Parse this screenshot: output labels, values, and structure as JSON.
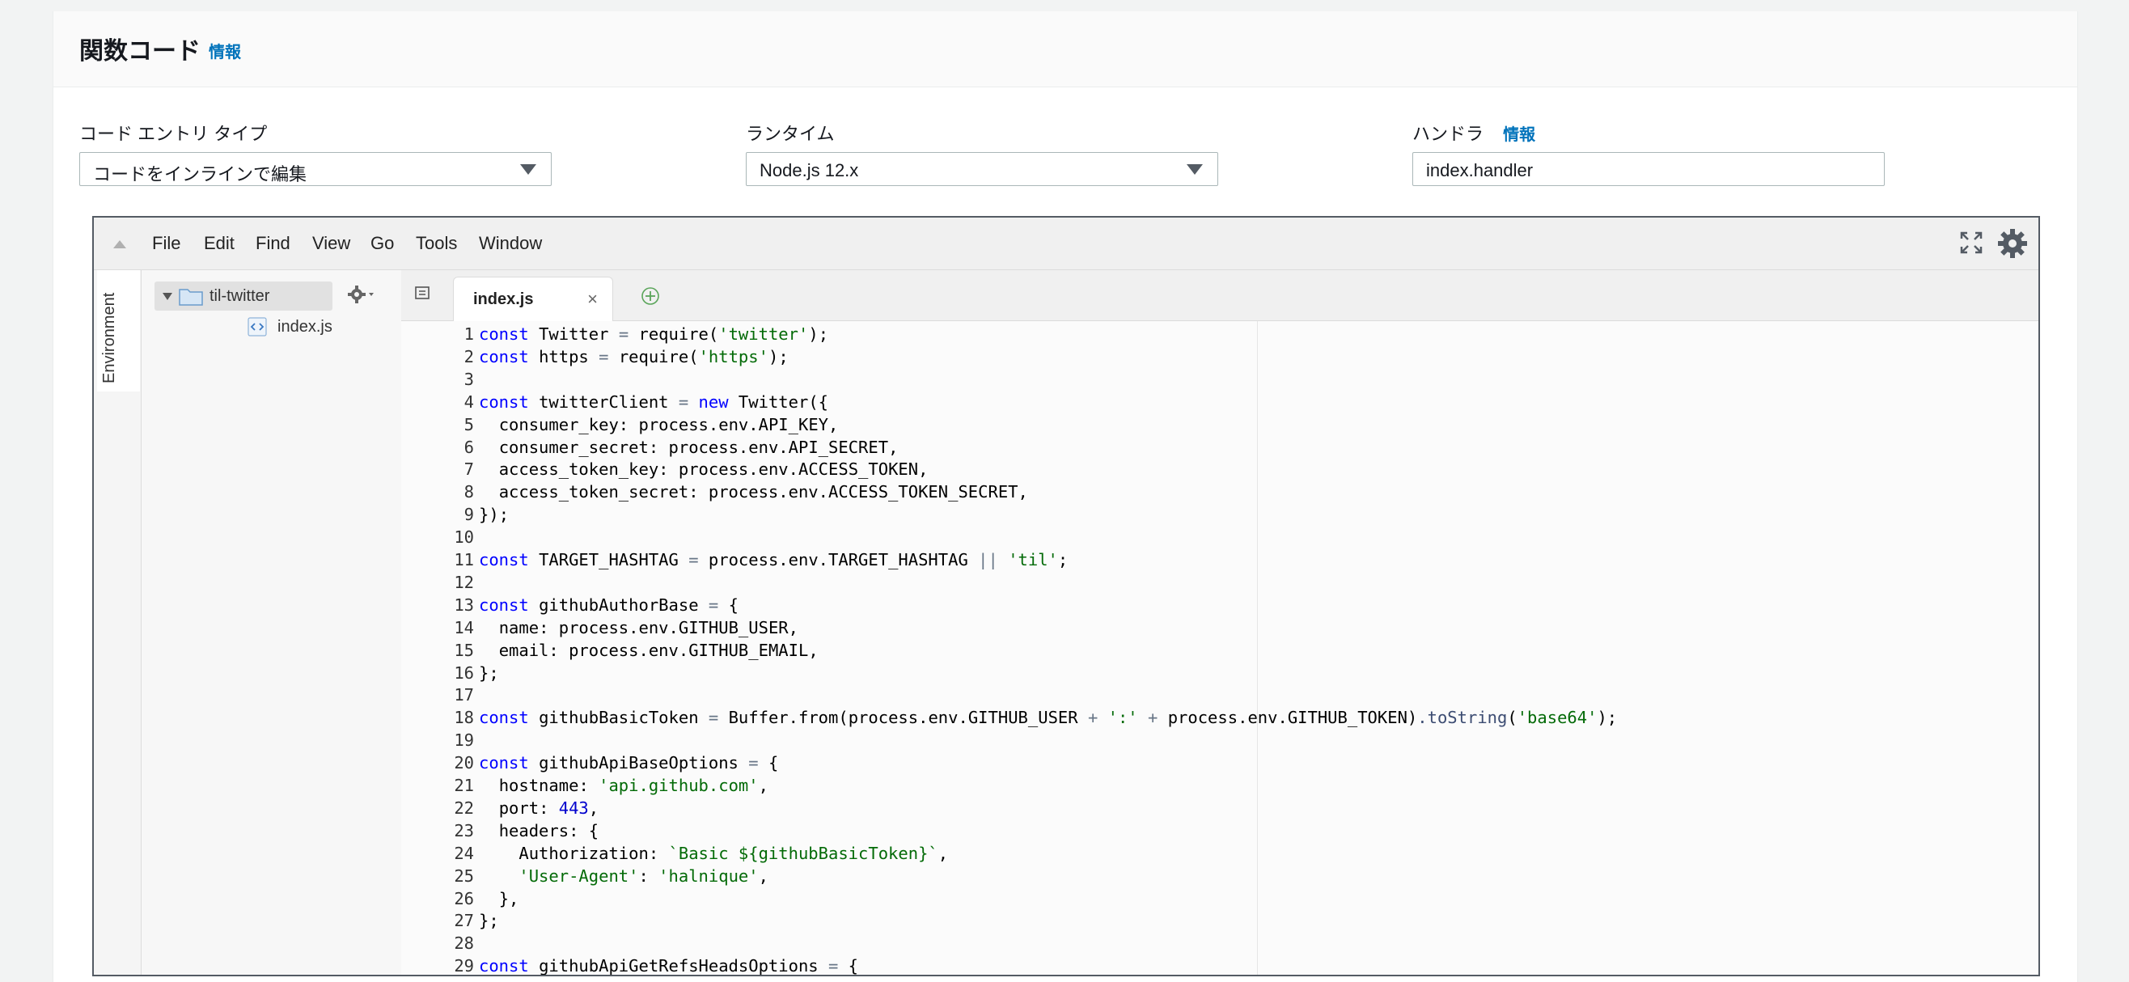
{
  "section": {
    "title": "関数コード",
    "info": "情報"
  },
  "fields": {
    "entry_type": {
      "label": "コード エントリ タイプ",
      "value": "コードをインラインで編集"
    },
    "runtime": {
      "label": "ランタイム",
      "value": "Node.js 12.x"
    },
    "handler": {
      "label": "ハンドラ",
      "info": "情報",
      "value": "index.handler"
    }
  },
  "ide": {
    "menu": [
      "File",
      "Edit",
      "Find",
      "View",
      "Go",
      "Tools",
      "Window"
    ],
    "env_label": "Environment",
    "tree": {
      "folder": "til-twitter",
      "file": "index.js"
    },
    "tab": {
      "label": "index.js",
      "close": "×"
    },
    "icons": {
      "collapse": "caret-up-icon",
      "fullscreen": "fullscreen-icon",
      "settings": "gear-icon",
      "tree_settings": "gear-dropdown-icon",
      "folder": "folder-icon",
      "file": "js-file-icon",
      "tab_list": "tab-list-icon",
      "add_tab": "plus-circle-icon"
    }
  },
  "code_lines": [
    {
      "n": "1",
      "t": "const Twitter = require('twitter');"
    },
    {
      "n": "2",
      "t": "const https = require('https');"
    },
    {
      "n": "3",
      "t": ""
    },
    {
      "n": "4",
      "t": "const twitterClient = new Twitter({"
    },
    {
      "n": "5",
      "t": "  consumer_key: process.env.API_KEY,"
    },
    {
      "n": "6",
      "t": "  consumer_secret: process.env.API_SECRET,"
    },
    {
      "n": "7",
      "t": "  access_token_key: process.env.ACCESS_TOKEN,"
    },
    {
      "n": "8",
      "t": "  access_token_secret: process.env.ACCESS_TOKEN_SECRET,"
    },
    {
      "n": "9",
      "t": "});"
    },
    {
      "n": "10",
      "t": ""
    },
    {
      "n": "11",
      "t": "const TARGET_HASHTAG = process.env.TARGET_HASHTAG || 'til';"
    },
    {
      "n": "12",
      "t": ""
    },
    {
      "n": "13",
      "t": "const githubAuthorBase = {"
    },
    {
      "n": "14",
      "t": "  name: process.env.GITHUB_USER,"
    },
    {
      "n": "15",
      "t": "  email: process.env.GITHUB_EMAIL,"
    },
    {
      "n": "16",
      "t": "};"
    },
    {
      "n": "17",
      "t": ""
    },
    {
      "n": "18",
      "t": "const githubBasicToken = Buffer.from(process.env.GITHUB_USER + ':' + process.env.GITHUB_TOKEN).toString('base64');"
    },
    {
      "n": "19",
      "t": ""
    },
    {
      "n": "20",
      "t": "const githubApiBaseOptions = {"
    },
    {
      "n": "21",
      "t": "  hostname: 'api.github.com',"
    },
    {
      "n": "22",
      "t": "  port: 443,"
    },
    {
      "n": "23",
      "t": "  headers: {"
    },
    {
      "n": "24",
      "t": "    Authorization: `Basic ${githubBasicToken}`,"
    },
    {
      "n": "25",
      "t": "    'User-Agent': 'halnique',"
    },
    {
      "n": "26",
      "t": "  },"
    },
    {
      "n": "27",
      "t": "};"
    },
    {
      "n": "28",
      "t": ""
    },
    {
      "n": "29",
      "t": "const githubApiGetRefsHeadsOptions = {"
    }
  ]
}
